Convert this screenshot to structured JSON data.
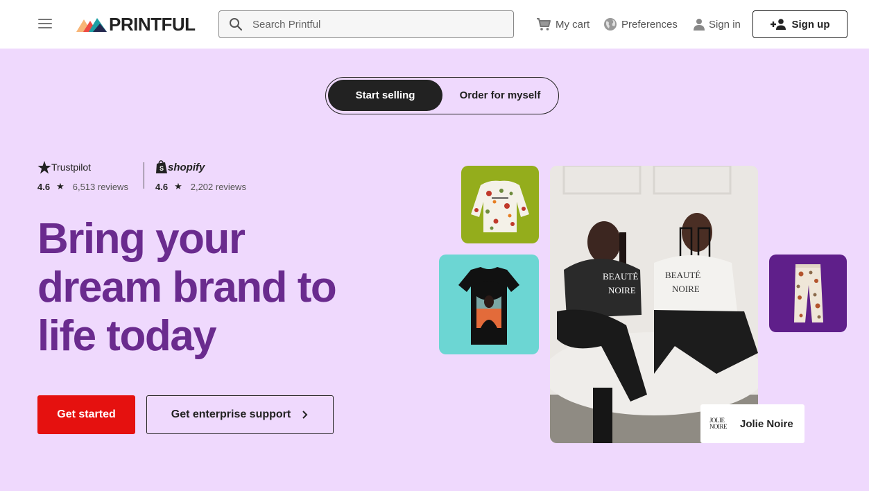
{
  "header": {
    "logo_text": "PRINTFUL",
    "search_placeholder": "Search Printful",
    "cart_label": "My cart",
    "preferences_label": "Preferences",
    "signin_label": "Sign in",
    "signup_label": "Sign up"
  },
  "toggle": {
    "active_label": "Start selling",
    "inactive_label": "Order for myself"
  },
  "ratings": {
    "trustpilot": {
      "brand": "Trustpilot",
      "score": "4.6",
      "reviews": "6,513 reviews"
    },
    "shopify": {
      "brand": "shopify",
      "score": "4.6",
      "reviews": "2,202 reviews"
    }
  },
  "hero": {
    "headline_line1": "Bring your",
    "headline_line2": "dream brand to",
    "headline_line3": "life today",
    "primary_cta": "Get started",
    "secondary_cta": "Get enterprise support"
  },
  "brand_card": {
    "mark_line1": "JOLIE",
    "mark_line2": "NOIRE",
    "name": "Jolie Noire"
  },
  "photo_shirts": {
    "left_line1": "BEAUTÉ",
    "left_line2": "NOIRE",
    "right_line1": "BEAUTÉ",
    "right_line2": "NOIRE"
  },
  "colors": {
    "background": "#efd9fd",
    "headline": "#6a2b8e",
    "primary_button": "#e5110f",
    "dark": "#222222"
  }
}
